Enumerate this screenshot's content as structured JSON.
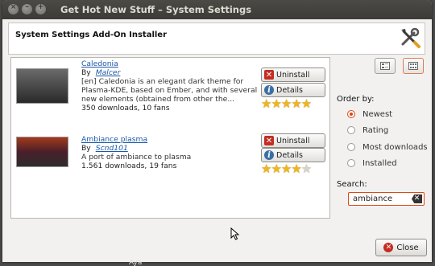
{
  "window": {
    "title": "Get Hot New Stuff – System Settings"
  },
  "header": {
    "title": "System Settings Add-On Installer"
  },
  "items": [
    {
      "name": "Caledonia",
      "by": "By",
      "author": "Malcer",
      "description": "[en] Caledonia is an elegant dark theme for Plasma-KDE, based on Ember, and with several new elements (obtained from other the...",
      "stats": "350 downloads, 10 fans",
      "uninstall_label": "Uninstall",
      "details_label": "Details",
      "rating": 5
    },
    {
      "name": "Ambiance plasma",
      "by": "By",
      "author": "Scnd101",
      "description": "A port of ambiance to plasma",
      "stats": "1.561 downloads, 19 fans",
      "uninstall_label": "Uninstall",
      "details_label": "Details",
      "rating": 4.5
    }
  ],
  "sidebar": {
    "order_label": "Order by:",
    "order_options": [
      "Newest",
      "Rating",
      "Most downloads",
      "Installed"
    ],
    "selected_order": "Newest",
    "search_label": "Search:",
    "search_value": "ambiance"
  },
  "footer": {
    "close_label": "Close"
  },
  "background_text": "Aya",
  "colors": {
    "accent": "#dd4814",
    "link": "#1a57a8",
    "star": "#f2b51f"
  }
}
